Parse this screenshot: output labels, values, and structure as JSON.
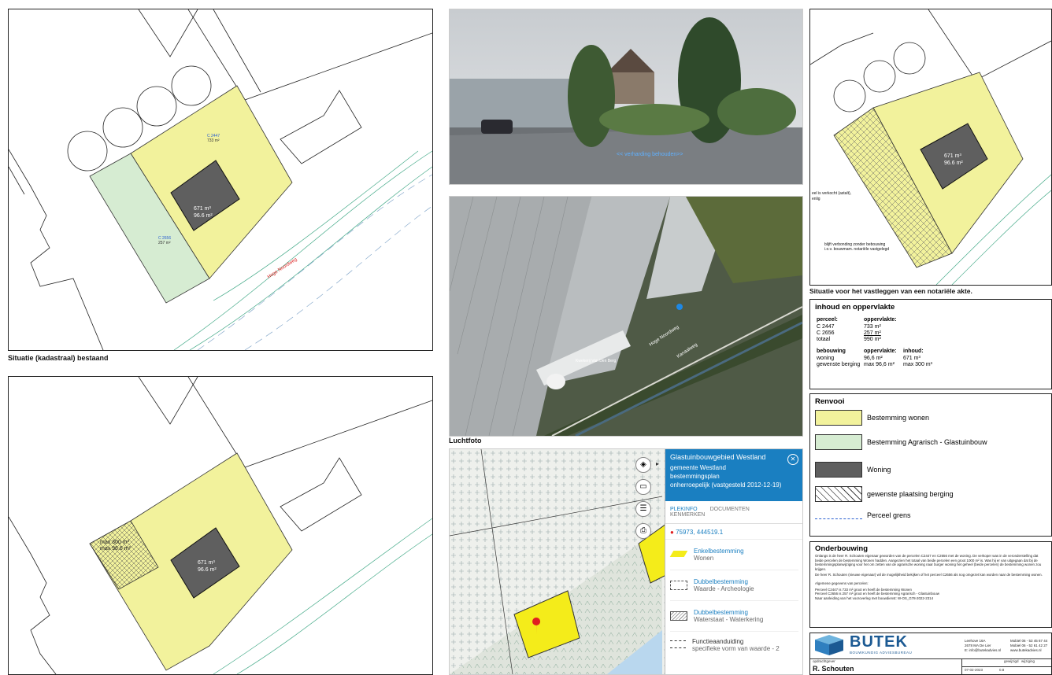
{
  "drawings": {
    "existing": {
      "caption": "Situatie (kadastraal) bestaand",
      "area_house": "671 m³",
      "area_house2": "96.6 m²",
      "parcel_a": "C 2447",
      "parcel_a_area": "733 m²",
      "parcel_b": "C 2656",
      "parcel_b_area": "257 m²",
      "road": "Hoge Noordweg"
    },
    "proposed": {
      "shed_max1": "max 300 m³",
      "shed_max2": "max 96.6 m²",
      "area_house": "671 m³",
      "area_house2": "96.6 m²"
    },
    "notary": {
      "caption": "Situatie voor het vastleggen van een notariële akte.",
      "area_house": "671 m³",
      "area_house2": "96.6 m²",
      "note1": "eel is verkocht (astalt),",
      "note2": "enlig",
      "note3": "blijft verbonding zonder bebouwing",
      "note4": "i.o.v. bouwmam. notariële vastgelegd"
    }
  },
  "photo": {
    "street_label": "<< verharding behouden>>"
  },
  "aerial": {
    "caption": "Luchtfoto",
    "road_label": "Hoge Noordweg",
    "road_label2": "Kanaalweg",
    "place_label": "Kwekerij Van Den Berg"
  },
  "map_panel": {
    "title": "Glastuinbouwgebied Westland",
    "line1": "gemeente Westland",
    "line2": "bestemmingsplan",
    "line3": "onherroepelijk (vastgesteld 2012-12-19)",
    "tabs": [
      "PLEKINFO",
      "DOCUMENTEN",
      "KENMERKEN"
    ],
    "coords": "75973, 444519.1",
    "items": [
      {
        "title": "Enkelbestemming",
        "sub": "Wonen"
      },
      {
        "title": "Dubbelbestemming",
        "sub": "Waarde - Archeologie"
      },
      {
        "title": "Dubbelbestemming",
        "sub": "Waterstaat - Waterkering"
      },
      {
        "title": "Functieaanduiding",
        "sub": "specifieke vorm van waarde - 2"
      }
    ]
  },
  "inhoud": {
    "title": "inhoud en oppervlakte",
    "h_perceel": "perceel:",
    "h_opp": "oppervlakte:",
    "rows": [
      {
        "k": "C 2447",
        "v": "733 m²"
      },
      {
        "k": "C 2656",
        "v": "257 m²"
      },
      {
        "k": "totaal",
        "v": "990 m²"
      }
    ],
    "h_bebouwing": "bebouwing",
    "h_opp2": "oppervlakte:",
    "h_inhoud": "inhoud:",
    "b_rows": [
      {
        "k": "woning",
        "v": "96,6 m²",
        "i": "671 m³"
      },
      {
        "k": "gewenste berging",
        "v": "max 96,6 m²",
        "i": "max 300 m³"
      }
    ]
  },
  "renvooi": {
    "title": "Renvooi",
    "items": [
      {
        "label": "Bestemming wonen",
        "color": "#f2f29c"
      },
      {
        "label": "Bestemming Agrarisch - Glastuinbouw",
        "color": "#d6ecd2"
      },
      {
        "label": "Woning",
        "color": "#5f5f5f"
      },
      {
        "label": "gewenste plaatsing berging",
        "color": "#ffffff"
      },
      {
        "label": "Perceel grens",
        "color": "#2a5fd0"
      }
    ]
  },
  "onderbouwing": {
    "title": "Onderbouwing",
    "p1": "Onlangs is de heer R. Schouten eigenaar geworden van de percelen C2447 en C2656 met de woning. De verkoper was in de veronderstelling dat beide percelen de bestemming Wonen hadden. Aangezien het totaal van beide percelen een groot 1000 m² is. Was hij er van uitgegaan dat bij de bestemmingsplanwijziging voor het om zetten van de agrarische woning naar burger woning het geheel (beide percelen) de bestemming wonen zou krijgen.",
    "p2": "De heer R. Schouten (nieuwe eigenaar) wil de mogelijkheid bekijken of het perceel C2656 als nog omgezet kan worden naar de bestemming wonen.",
    "p3": "Algemene gegevens van percelen:",
    "p4": "Perceel C2447 is 733 m² groot en heeft de bestemming Wonen",
    "p5": "Perceel C2656 is 257 m² groot en heeft de bestemming Agrarisch - Glastuinbouw",
    "p6": "Naar aanleiding van het vooroverleg met bouwdienst: W-OS_G78-2022-2314"
  },
  "titleblock": {
    "brand": "BUTEK",
    "brand_sub": "BOUWKUNDIG ADVIESBUREAU",
    "addr1": "Leehove 16A",
    "addr2": "2678 MA De Lier",
    "addr3": "E: info@butekadvies.nl",
    "tel1": "Mobiel 06 - 53 45 67 44",
    "tel2": "Mobiel 06 - 52 61 42 27",
    "web": "www.butekadvies.nl",
    "opdrachtgever_label": "opdrachtgever",
    "client": "R. Schouten",
    "date": "07-02-2023",
    "gewijzigd_label": "gewijzigd",
    "wijziging_label": "wijziging",
    "sheet": "0.8"
  }
}
